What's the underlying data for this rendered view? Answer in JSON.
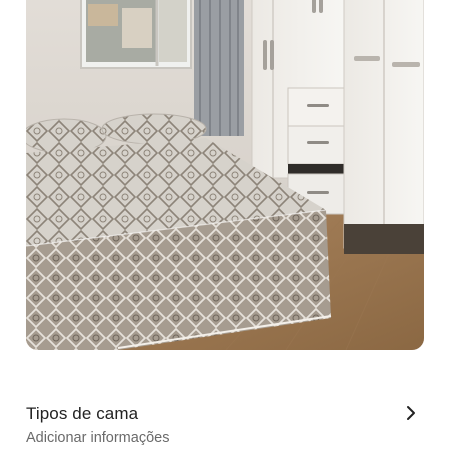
{
  "listing": {
    "photo": {
      "description_icon": "bedroom-photo"
    },
    "section": {
      "title": "Tipos de cama",
      "subtitle": "Adicionar informações",
      "action_icon": "chevron-right-icon"
    }
  }
}
